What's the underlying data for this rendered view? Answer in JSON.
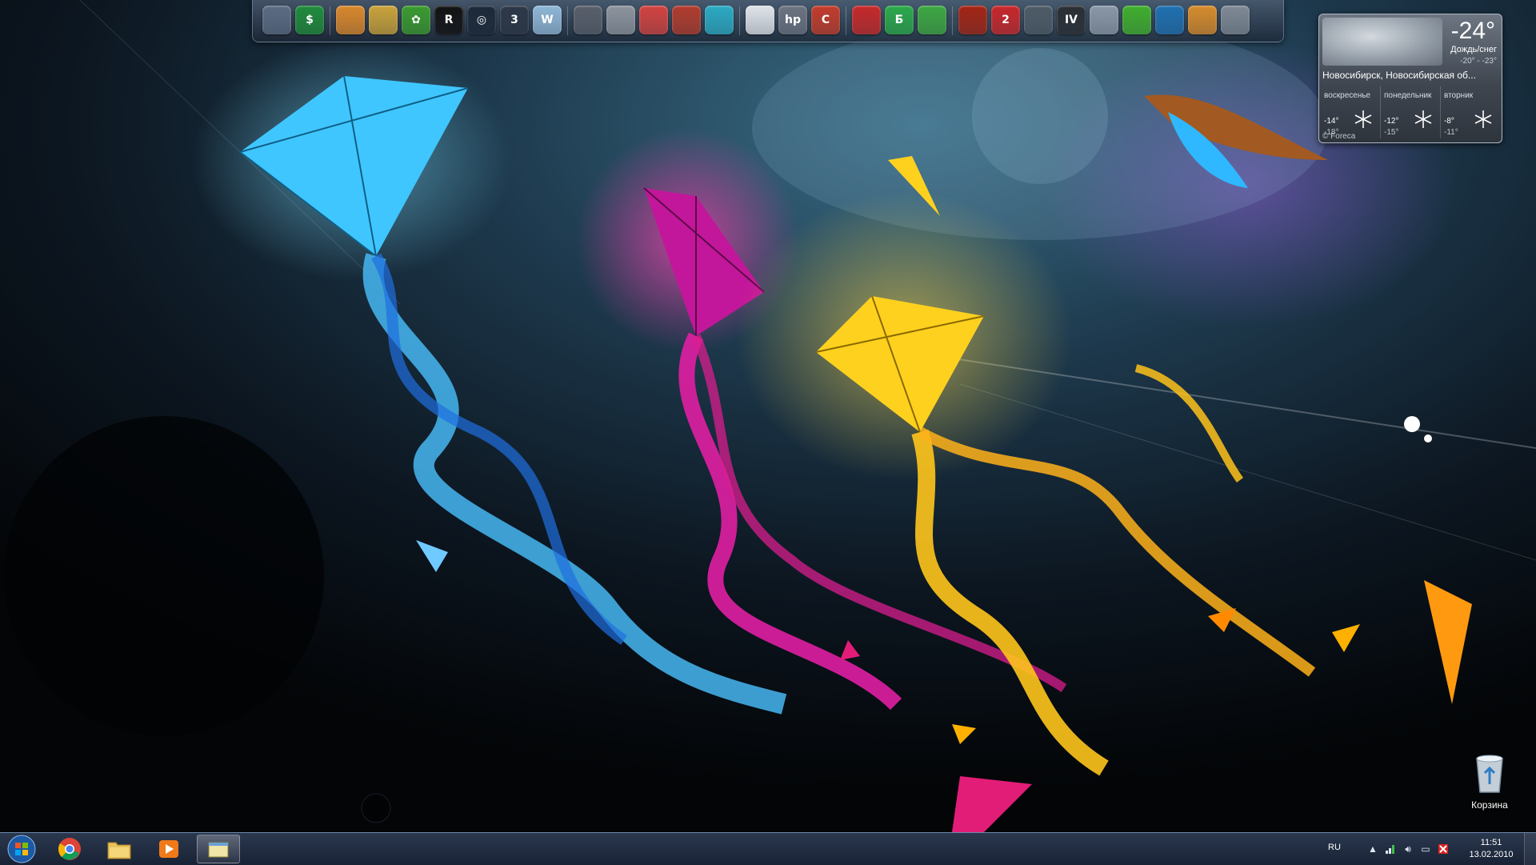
{
  "dock": {
    "groups": [
      [
        {
          "icon": "slideshow-icon",
          "glyph": "",
          "color": "#5a6b82"
        },
        {
          "icon": "money-icon",
          "glyph": "$",
          "color": "#1f8a3b"
        }
      ],
      [
        {
          "icon": "contacts-icon",
          "glyph": "",
          "color": "#d9872b"
        },
        {
          "icon": "tags-icon",
          "glyph": "",
          "color": "#c9a23a"
        },
        {
          "icon": "icq-flower-icon",
          "glyph": "✿",
          "color": "#3a9a2e"
        },
        {
          "icon": "rockstar-icon",
          "glyph": "R",
          "color": "#111111"
        },
        {
          "icon": "steam-icon",
          "glyph": "◎",
          "color": "#1b2838"
        },
        {
          "icon": "three-icon",
          "glyph": "3",
          "color": "#2b3646"
        },
        {
          "icon": "wavelab-icon",
          "glyph": "W",
          "color": "#8fb6d6"
        }
      ],
      [
        {
          "icon": "film-icon",
          "glyph": "",
          "color": "#585e6a"
        },
        {
          "icon": "camera-icon",
          "glyph": "",
          "color": "#8c939c"
        },
        {
          "icon": "colors-icon",
          "glyph": "",
          "color": "#d2423f"
        },
        {
          "icon": "pen-tool-icon",
          "glyph": "",
          "color": "#b13a2c"
        },
        {
          "icon": "feather-icon",
          "glyph": "",
          "color": "#2aa9c2"
        }
      ],
      [
        {
          "icon": "phone-icon",
          "glyph": "",
          "color": "#dfe3e8"
        },
        {
          "icon": "hp-icon",
          "glyph": "hp",
          "color": "#6b7280"
        },
        {
          "icon": "magnet-icon",
          "glyph": "C",
          "color": "#c23b2a"
        }
      ],
      [
        {
          "icon": "red-book-icon",
          "glyph": "",
          "color": "#c62828"
        },
        {
          "icon": "b3-icon",
          "glyph": "Б",
          "color": "#2aa84a"
        },
        {
          "icon": "green-orb-icon",
          "glyph": "",
          "color": "#3ca640"
        }
      ],
      [
        {
          "icon": "flame-icon",
          "glyph": "",
          "color": "#a32313"
        },
        {
          "icon": "game-2-icon",
          "glyph": "2",
          "color": "#c8262a"
        },
        {
          "icon": "shield-icon",
          "glyph": "",
          "color": "#4d5a66"
        },
        {
          "icon": "gta-iv-icon",
          "glyph": "IV",
          "color": "#2a2d33"
        },
        {
          "icon": "blade-icon",
          "glyph": "",
          "color": "#8a97a6"
        },
        {
          "icon": "green-man-icon",
          "glyph": "",
          "color": "#3fae2c"
        },
        {
          "icon": "blue-disc-icon",
          "glyph": "",
          "color": "#1e6fb0"
        },
        {
          "icon": "game-character-icon",
          "glyph": "",
          "color": "#d68a2a"
        },
        {
          "icon": "alien-icon",
          "glyph": "",
          "color": "#7e8894"
        }
      ]
    ]
  },
  "weather": {
    "temperature": "-24°",
    "condition": "Дождь/снег",
    "range": "-20° - -23°",
    "location": "Новосибирск, Новосибирская об...",
    "days": [
      {
        "name": "воскресенье",
        "high": "-14°",
        "low": "-18°"
      },
      {
        "name": "понедельник",
        "high": "-12°",
        "low": "-15°"
      },
      {
        "name": "вторник",
        "high": "-8°",
        "low": "-11°"
      }
    ],
    "credit": "© Foreca"
  },
  "desktop": {
    "recycle_bin_label": "Корзина"
  },
  "taskbar": {
    "pinned": [
      {
        "name": "chrome-icon"
      },
      {
        "name": "explorer-icon"
      },
      {
        "name": "media-player-icon"
      },
      {
        "name": "active-window-icon",
        "active": true
      }
    ],
    "language": "RU",
    "time": "11:51",
    "date": "13.02.2010"
  }
}
